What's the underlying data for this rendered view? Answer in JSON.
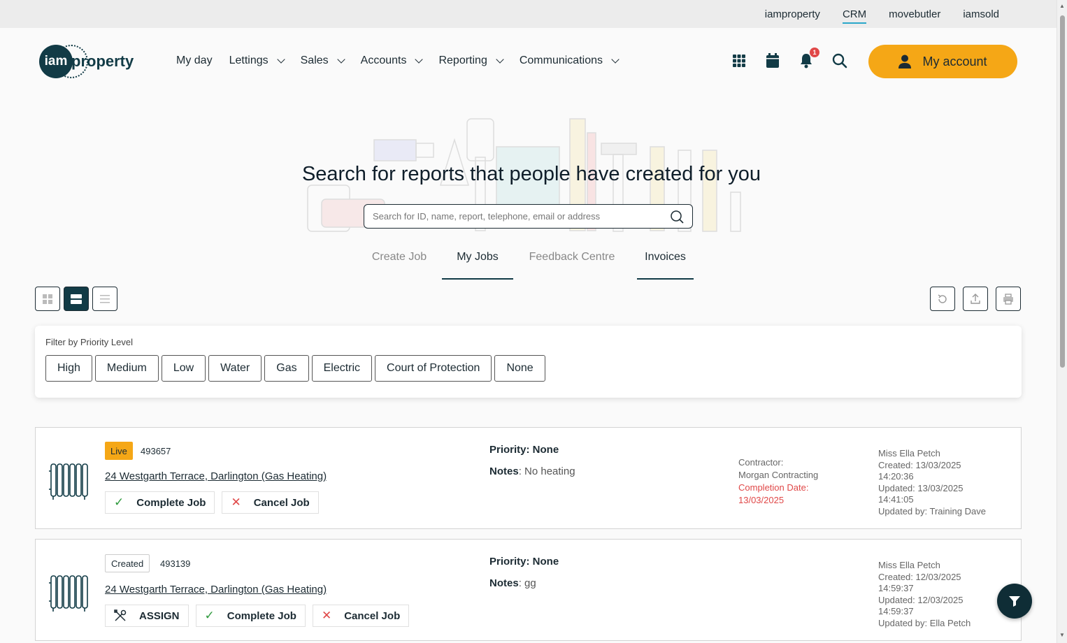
{
  "topbar": {
    "links": [
      "iamproperty",
      "CRM",
      "movebutler",
      "iamsold"
    ]
  },
  "logo": {
    "mark": "iam",
    "word": "property"
  },
  "nav": {
    "items": [
      {
        "label": "My day"
      },
      {
        "label": "Lettings"
      },
      {
        "label": "Sales"
      },
      {
        "label": "Accounts"
      },
      {
        "label": "Reporting"
      },
      {
        "label": "Communications"
      }
    ]
  },
  "header": {
    "notification_count": "1",
    "account_label": "My account"
  },
  "hero": {
    "title": "Search for reports that people have created for you",
    "search_placeholder": "Search for ID, name, report, telephone, email or address"
  },
  "tabs": [
    "Create Job",
    "My Jobs",
    "Feedback Centre",
    "Invoices"
  ],
  "filter": {
    "label": "Filter by Priority Level",
    "chips": [
      "High",
      "Medium",
      "Low",
      "Water",
      "Gas",
      "Electric",
      "Court of Protection",
      "None"
    ]
  },
  "jobs": [
    {
      "status": "Live",
      "id": "493657",
      "address": "24 Westgarth Terrace, Darlington (Gas Heating)",
      "actions": [
        "Complete Job",
        "Cancel Job"
      ],
      "priority": "Priority: None",
      "notes_label": "Notes",
      "notes": ": No heating",
      "contractor_label": "Contractor:",
      "contractor": "Morgan Contracting",
      "completion_label": "Completion Date:",
      "completion_date": "13/03/2025",
      "person": "Miss Ella Petch",
      "created": "Created: 13/03/2025",
      "created_time": "14:20:36",
      "updated": "Updated: 13/03/2025",
      "updated_time": "14:41:05",
      "updated_by": "Updated by: Training Dave"
    },
    {
      "status": "Created",
      "id": "493139",
      "address": "24 Westgarth Terrace, Darlington (Gas Heating)",
      "actions": [
        "ASSIGN",
        "Complete Job",
        "Cancel Job"
      ],
      "priority": "Priority: None",
      "notes_label": "Notes",
      "notes": ": gg",
      "person": "Miss Ella Petch",
      "created": "Created: 12/03/2025",
      "created_time": "14:59:37",
      "updated": "Updated: 12/03/2025",
      "updated_time": "14:59:37",
      "updated_by": "Updated by: Ella Petch"
    }
  ],
  "colors": {
    "accent": "#f5a716",
    "brand": "#123b46",
    "danger": "#e04848",
    "success": "#2f9a3e"
  },
  "icons": [
    "apps-grid-icon",
    "calendar-icon",
    "bell-icon",
    "search-icon",
    "user-icon",
    "radiator-icon",
    "filter-icon",
    "refresh-icon",
    "export-icon",
    "print-icon"
  ]
}
